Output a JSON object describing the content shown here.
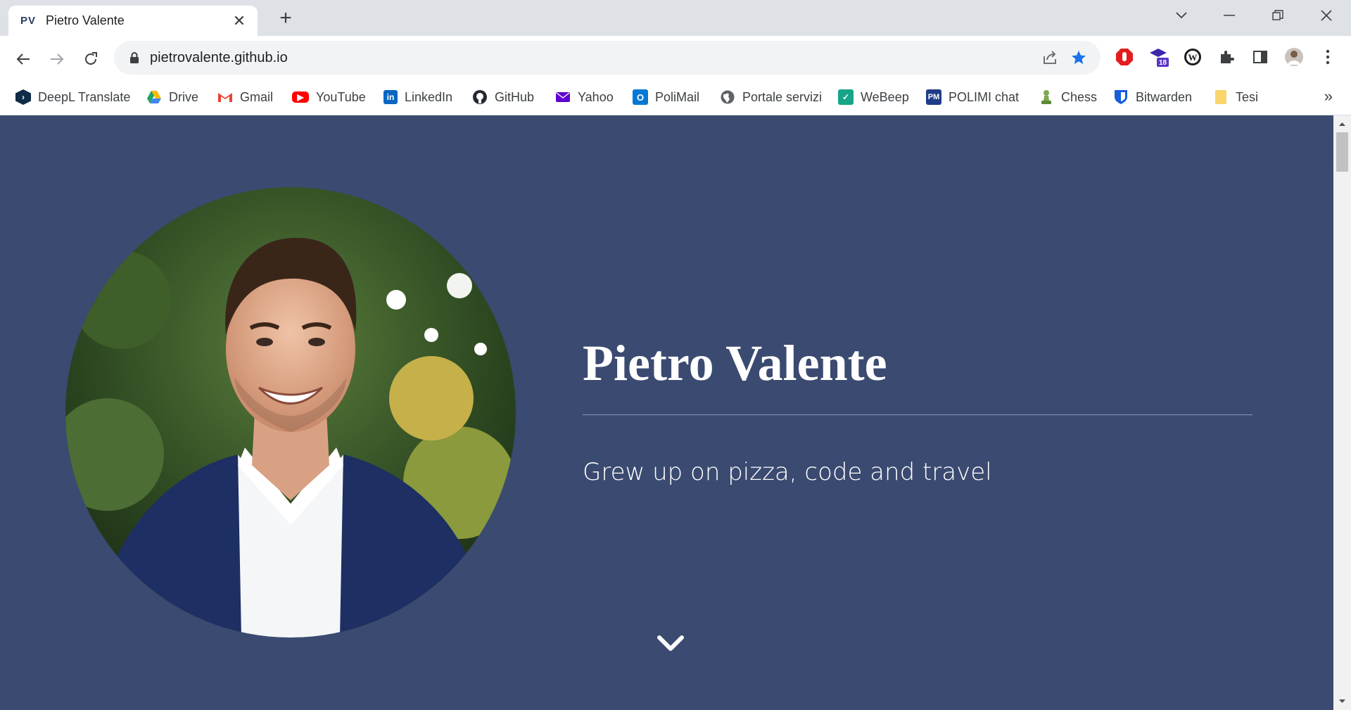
{
  "browser": {
    "tab": {
      "favicon_text": "PV",
      "title": "Pietro Valente"
    },
    "address": {
      "url": "pietrovalente.github.io"
    },
    "extensions": {
      "badge_count": "18"
    },
    "bookmarks": [
      {
        "label": "DeepL Translate",
        "icon": "deepl-icon",
        "color": "#0f2b46"
      },
      {
        "label": "Drive",
        "icon": "drive-icon",
        "color": "#1fa463"
      },
      {
        "label": "Gmail",
        "icon": "gmail-icon",
        "color": "#ea4335"
      },
      {
        "label": "YouTube",
        "icon": "youtube-icon",
        "color": "#ff0000"
      },
      {
        "label": "LinkedIn",
        "icon": "linkedin-icon",
        "color": "#0a66c2"
      },
      {
        "label": "GitHub",
        "icon": "github-icon",
        "color": "#24292f"
      },
      {
        "label": "Yahoo",
        "icon": "yahoo-mail-icon",
        "color": "#6001d2"
      },
      {
        "label": "PoliMail",
        "icon": "outlook-icon",
        "color": "#0078d4"
      },
      {
        "label": "Portale servizi",
        "icon": "globe-icon",
        "color": "#5f6368"
      },
      {
        "label": "WeBeep",
        "icon": "webeep-check-icon",
        "color": "#17a589"
      },
      {
        "label": "POLIMI chat",
        "icon": "polimi-icon",
        "color": "#1f3c88"
      },
      {
        "label": "Chess",
        "icon": "chess-pawn-icon",
        "color": "#7fa650"
      },
      {
        "label": "Bitwarden",
        "icon": "bitwarden-icon",
        "color": "#175ddc"
      },
      {
        "label": "Tesi",
        "icon": "folder-icon",
        "color": "#f9d66b"
      }
    ]
  },
  "hero": {
    "name": "Pietro Valente",
    "tagline": "Grew up on pizza, code and travel"
  },
  "colors": {
    "page_background": "#3b4a70",
    "accent_star": "#1a73e8"
  }
}
